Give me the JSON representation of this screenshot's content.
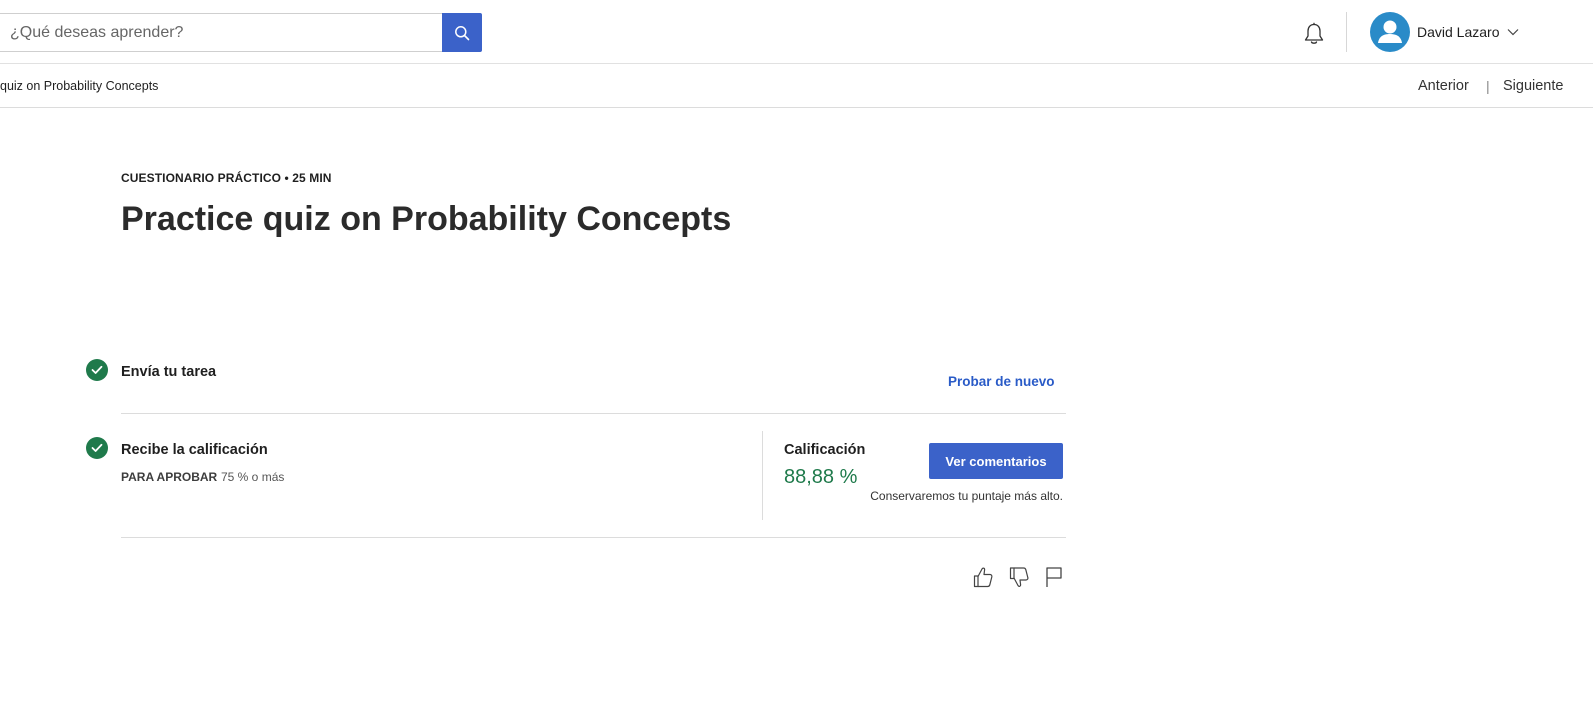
{
  "search": {
    "placeholder": "¿Qué deseas aprender?"
  },
  "header": {
    "user_name": "David Lazaro",
    "icons": [
      "search-icon",
      "bell-icon",
      "avatar-icon",
      "chevron-down-icon"
    ]
  },
  "breadcrumb": {
    "text": "quiz on Probability Concepts",
    "prev_label": "Anterior",
    "separator": "|",
    "next_label": "Siguiente"
  },
  "page": {
    "kicker": "CUESTIONARIO PRÁCTICO • 25 MIN",
    "title": "Practice quiz on Probability Concepts"
  },
  "steps": {
    "submit": {
      "title": "Envía tu tarea",
      "retry_label": "Probar de nuevo"
    },
    "grade": {
      "title": "Recibe la calificación",
      "pass_label": "PARA APROBAR",
      "pass_value": "75 % o más",
      "grade_label": "Calificación",
      "grade_value": "88,88 %",
      "feedback_button": "Ver comentarios",
      "keep_note": "Conservaremos tu puntaje más alto."
    }
  },
  "feedback_icons": [
    "thumbs-up-icon",
    "thumbs-down-icon",
    "flag-icon"
  ],
  "colors": {
    "accent": "#3b62c9",
    "success": "#1f7a4b",
    "link": "#2a5bc7",
    "avatar": "#2a8bc8"
  }
}
